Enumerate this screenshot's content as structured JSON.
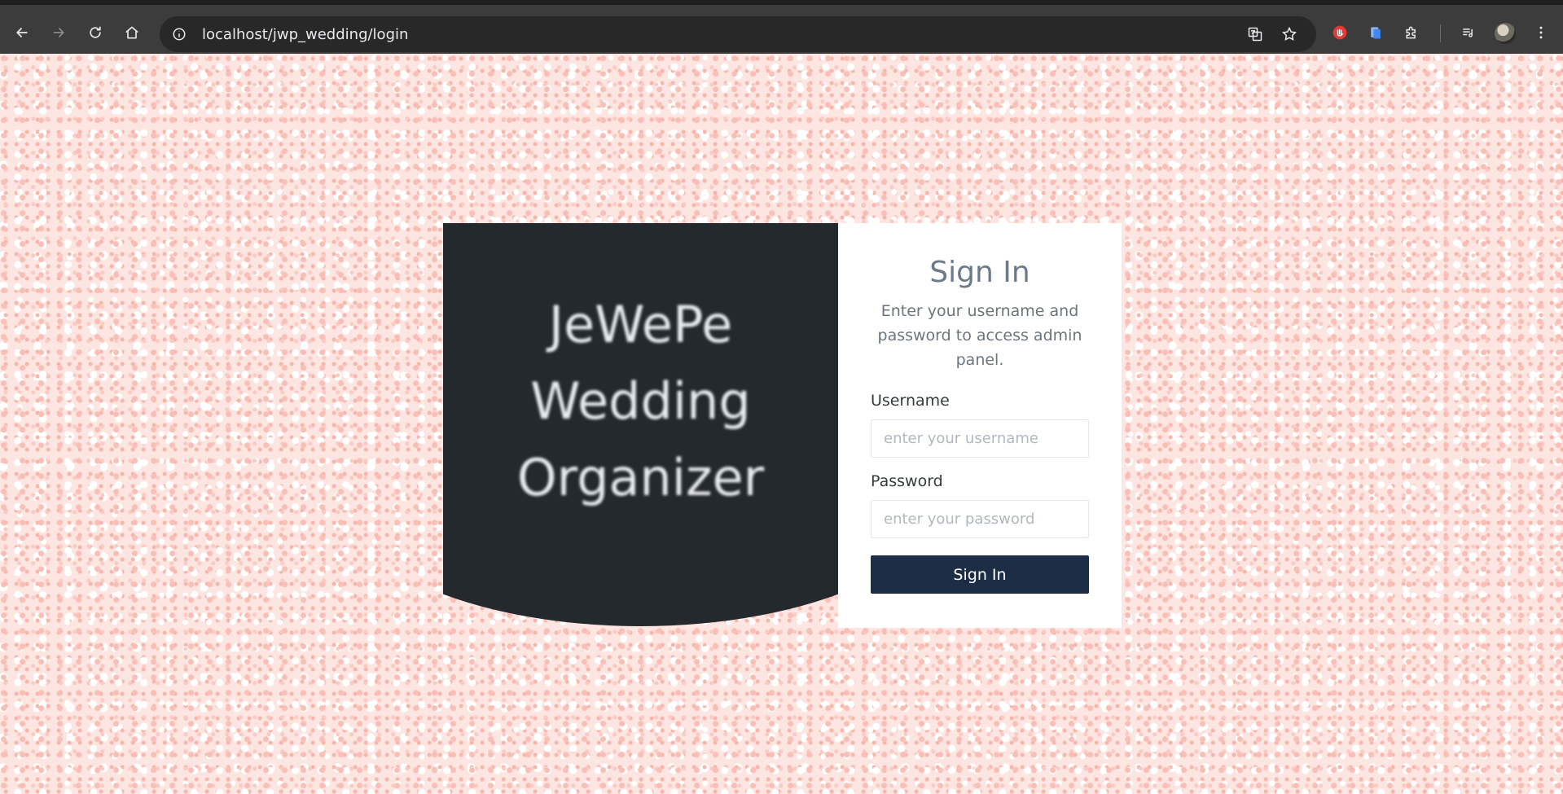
{
  "browser": {
    "url": "localhost/jwp_wedding/login"
  },
  "brand": {
    "line1": "JeWePe",
    "line2": "Wedding",
    "line3": "Organizer"
  },
  "form": {
    "title": "Sign In",
    "description": "Enter your username and password to access admin panel.",
    "username_label": "Username",
    "username_placeholder": "enter your username",
    "username_value": "",
    "password_label": "Password",
    "password_placeholder": "enter your password",
    "password_value": "",
    "submit_label": "Sign In"
  },
  "colors": {
    "brand_panel": "#23292d",
    "button": "#1c2d45",
    "background_pink": "#fde5e1"
  }
}
